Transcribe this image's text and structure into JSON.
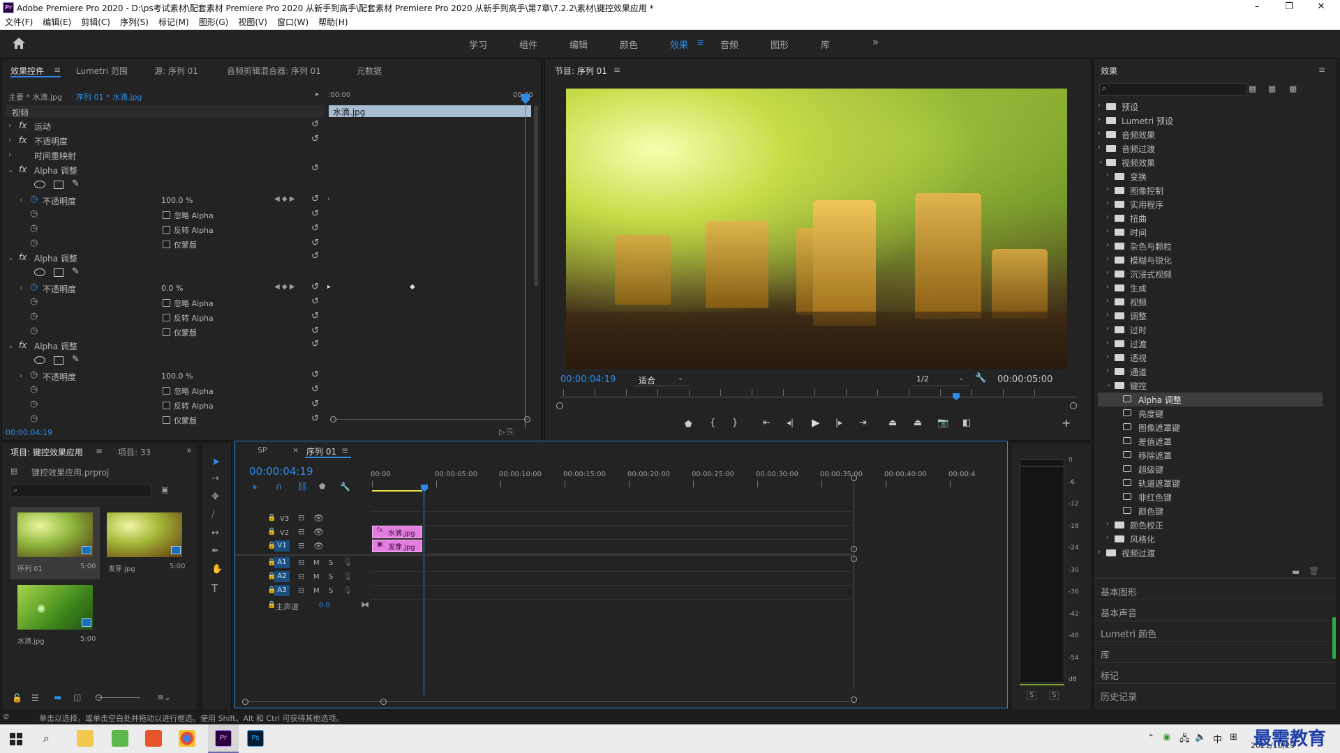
{
  "window": {
    "title": "Adobe Premiere Pro 2020 - D:\\ps考试素材\\配套素材 Premiere Pro 2020 从新手到高手\\配套素材 Premiere Pro 2020 从新手到高手\\第7章\\7.2.2\\素材\\键控效果应用 *",
    "app_icon": "Pr",
    "controls": {
      "minimize": "–",
      "maximize": "❐",
      "close": "✕"
    }
  },
  "menu": [
    "文件(F)",
    "编辑(E)",
    "剪辑(C)",
    "序列(S)",
    "标记(M)",
    "图形(G)",
    "视图(V)",
    "窗口(W)",
    "帮助(H)"
  ],
  "workspaces": {
    "items": [
      "学习",
      "组件",
      "编辑",
      "颜色",
      "效果",
      "音频",
      "图形",
      "库"
    ],
    "active": "效果",
    "more": "»"
  },
  "effect_controls": {
    "tabs": [
      "效果控件",
      "Lumetri 范围",
      "源: 序列 01",
      "音频剪辑混合器: 序列 01",
      "元数据"
    ],
    "master_clip": "主要 * 水滴.jpg",
    "sequence_clip": "序列 01 * 水滴.jpg",
    "section_video": "视频",
    "timeline_start": ":00:00",
    "timeline_end": "00:00",
    "clip_label": "水滴.jpg",
    "rows": {
      "motion": "运动",
      "opacity": "不透明度",
      "time_remap": "时间重映射",
      "alpha_adjust": "Alpha 调整",
      "opacity_param": "不透明度",
      "ignore_alpha": "忽略 Alpha",
      "invert_alpha": "反转 Alpha",
      "mask_only": "仅蒙版"
    },
    "alpha_effects": [
      {
        "name": "Alpha 调整",
        "opacity_value": "100.0 %"
      },
      {
        "name": "Alpha 调整",
        "opacity_value": "0.0 %"
      },
      {
        "name": "Alpha 调整",
        "opacity_value": "100.0 %"
      }
    ],
    "current_time": "00:00:04:19",
    "fx_label": "fx"
  },
  "program": {
    "title": "节目: 序列 01",
    "timecode": "00:00:04:19",
    "fit": "适合",
    "resolution": "1/2",
    "duration": "00:00:05:00"
  },
  "project": {
    "tabs": [
      "项目: 键控效果应用",
      "项目: 33"
    ],
    "file": "键控效果应用.prproj",
    "items": [
      {
        "name": "序列 01",
        "duration": "5:00"
      },
      {
        "name": "发芽.jpg",
        "duration": "5:00"
      },
      {
        "name": "水滴.jpg",
        "duration": "5:00"
      }
    ]
  },
  "timeline": {
    "tabs": [
      "SP",
      "序列 01"
    ],
    "timecode": "00:00:04:19",
    "ruler": [
      "00:00",
      "00:00:05:00",
      "00:00:10:00",
      "00:00:15:00",
      "00:00:20:00",
      "00:00:25:00",
      "00:00:30:00",
      "00:00:35:00",
      "00:00:40:00",
      "00:00:4"
    ],
    "video_tracks": [
      "V3",
      "V2",
      "V1"
    ],
    "audio_tracks": [
      "A1",
      "A2",
      "A3"
    ],
    "mute": "M",
    "solo": "S",
    "master": "主声道",
    "master_value": "0.0",
    "clips": [
      {
        "track": "V2",
        "name": "水滴.jpg"
      },
      {
        "track": "V1",
        "name": "发芽.jpg"
      }
    ]
  },
  "audio_meter": {
    "scale": [
      "0",
      "-6",
      "-12",
      "-18",
      "-24",
      "-30",
      "-36",
      "-42",
      "-48",
      "-54",
      "dB"
    ],
    "solo_labels": [
      "S",
      "S"
    ]
  },
  "effects": {
    "title": "效果",
    "tree": [
      {
        "label": "预设",
        "level": 0,
        "kind": "folder"
      },
      {
        "label": "Lumetri 预设",
        "level": 0,
        "kind": "folder"
      },
      {
        "label": "音频效果",
        "level": 0,
        "kind": "folder"
      },
      {
        "label": "音频过渡",
        "level": 0,
        "kind": "folder"
      },
      {
        "label": "视频效果",
        "level": 0,
        "kind": "folder",
        "open": true
      },
      {
        "label": "变换",
        "level": 1,
        "kind": "folder"
      },
      {
        "label": "图像控制",
        "level": 1,
        "kind": "folder"
      },
      {
        "label": "实用程序",
        "level": 1,
        "kind": "folder"
      },
      {
        "label": "扭曲",
        "level": 1,
        "kind": "folder"
      },
      {
        "label": "时间",
        "level": 1,
        "kind": "folder"
      },
      {
        "label": "杂色与颗粒",
        "level": 1,
        "kind": "folder"
      },
      {
        "label": "模糊与锐化",
        "level": 1,
        "kind": "folder"
      },
      {
        "label": "沉浸式视频",
        "level": 1,
        "kind": "folder"
      },
      {
        "label": "生成",
        "level": 1,
        "kind": "folder"
      },
      {
        "label": "视频",
        "level": 1,
        "kind": "folder"
      },
      {
        "label": "调整",
        "level": 1,
        "kind": "folder"
      },
      {
        "label": "过时",
        "level": 1,
        "kind": "folder"
      },
      {
        "label": "过渡",
        "level": 1,
        "kind": "folder"
      },
      {
        "label": "透视",
        "level": 1,
        "kind": "folder"
      },
      {
        "label": "通道",
        "level": 1,
        "kind": "folder"
      },
      {
        "label": "键控",
        "level": 1,
        "kind": "folder",
        "open": true
      },
      {
        "label": "Alpha 调整",
        "level": 2,
        "kind": "effect",
        "selected": true
      },
      {
        "label": "亮度键",
        "level": 2,
        "kind": "effect"
      },
      {
        "label": "图像遮罩键",
        "level": 2,
        "kind": "effect"
      },
      {
        "label": "差值遮罩",
        "level": 2,
        "kind": "effect"
      },
      {
        "label": "移除遮罩",
        "level": 2,
        "kind": "effect"
      },
      {
        "label": "超级键",
        "level": 2,
        "kind": "effect"
      },
      {
        "label": "轨道遮罩键",
        "level": 2,
        "kind": "effect"
      },
      {
        "label": "非红色键",
        "level": 2,
        "kind": "effect"
      },
      {
        "label": "颜色键",
        "level": 2,
        "kind": "effect"
      },
      {
        "label": "颜色校正",
        "level": 1,
        "kind": "folder"
      },
      {
        "label": "风格化",
        "level": 1,
        "kind": "folder"
      },
      {
        "label": "视频过渡",
        "level": 0,
        "kind": "folder"
      }
    ],
    "bottom_panels": [
      "基本图形",
      "基本声音",
      "Lumetri 颜色",
      "库",
      "标记",
      "历史记录"
    ]
  },
  "status_bar": "单击以选择，或单击空白处并拖动以进行框选。使用 Shift、Alt 和 Ctrl 可获得其他选项。",
  "taskbar": {
    "ime": "中",
    "time": "2021/10/29",
    "watermark": "最需教育"
  },
  "colors": {
    "accent": "#2d8ceb",
    "clip_pink": "#e27ee0",
    "panel": "#232323",
    "playhead": "#2d8ceb"
  }
}
